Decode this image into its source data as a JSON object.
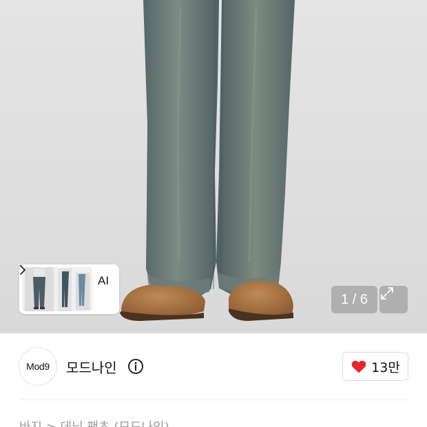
{
  "gallery": {
    "counter": "1 / 6",
    "ai_label": "AI"
  },
  "brand": {
    "logo_text": "Mod9",
    "name": "모드나인"
  },
  "like": {
    "count": "13만"
  },
  "breadcrumb": {
    "text": "바지 > 데님 팬츠 (모드나인)"
  },
  "colors": {
    "accent_heart": "#e8262b",
    "denim": "#5b6a6a",
    "boot": "#a8703f"
  },
  "icons": [
    "chevron-right-icon",
    "expand-icon",
    "info-icon",
    "heart-icon"
  ]
}
